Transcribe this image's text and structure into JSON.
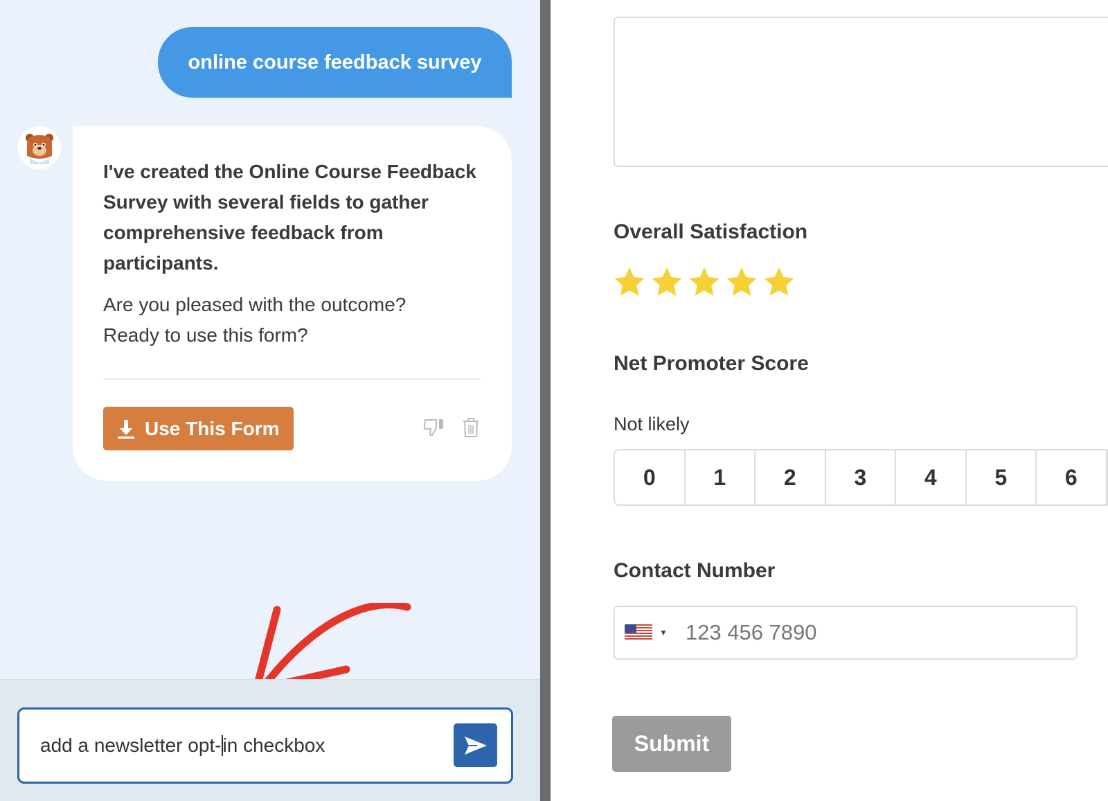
{
  "chat": {
    "user_message": "online course feedback survey",
    "bot_message_bold": "I've created the Online Course Feedback Survey with several fields to gather comprehensive feedback from participants.",
    "bot_message_question_1": "Are you pleased with the outcome?",
    "bot_message_question_2": "Ready to use this form?",
    "use_form_label": "Use This Form",
    "input_value_before_caret": "add a newsletter opt-",
    "input_value_after_caret": "in checkbox"
  },
  "form": {
    "satisfaction_label": "Overall Satisfaction",
    "rating": {
      "value": 5,
      "max": 5
    },
    "nps_label": "Net Promoter Score",
    "nps_low_label": "Not likely",
    "nps_options": [
      "0",
      "1",
      "2",
      "3",
      "4",
      "5",
      "6"
    ],
    "contact_label": "Contact Number",
    "phone_placeholder": "123 456 7890",
    "country": "US",
    "submit_label": "Submit"
  },
  "colors": {
    "user_bubble": "#4598e6",
    "use_form_button": "#d67d40",
    "send_button": "#2d65ad",
    "star": "#f7d035",
    "annotation_arrow": "#e5352b",
    "submit": "#9b9b9b"
  }
}
